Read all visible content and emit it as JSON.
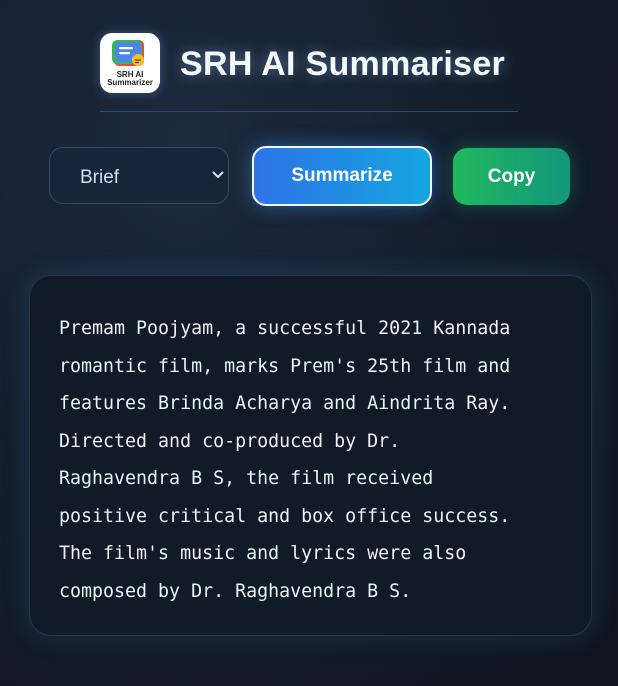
{
  "header": {
    "title": "SRH AI Summariser",
    "logo": {
      "icon": "chat-bubble-icon",
      "text_line1": "SRH AI",
      "text_line2": "Summarizer"
    }
  },
  "controls": {
    "length_select": {
      "selected": "Brief"
    },
    "summarize_label": "Summarize",
    "copy_label": "Copy"
  },
  "output": {
    "text": "Premam Poojyam, a successful 2021 Kannada\nromantic film, marks Prem's 25th film and\nfeatures Brinda Acharya and Aindrita Ray.\nDirected and co-produced by Dr.\nRaghavendra B S, the film received\npositive critical and box office success.\nThe film's music and lyrics were also\ncomposed by Dr. Raghavendra B S."
  },
  "colors": {
    "summarize_gradient": [
      "#2d73e6",
      "#14a6e0"
    ],
    "copy_gradient": [
      "#20b860",
      "#13977a"
    ],
    "background": "#141e2c"
  }
}
